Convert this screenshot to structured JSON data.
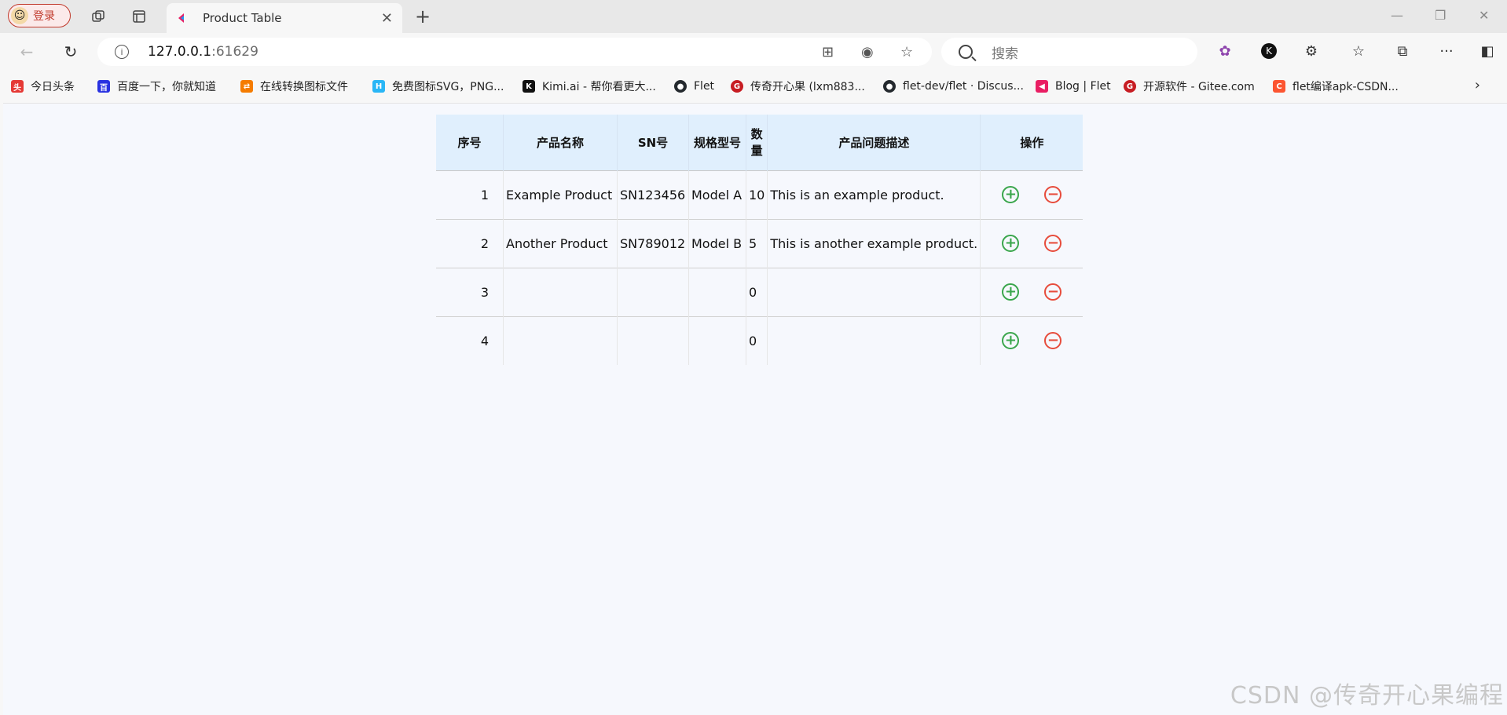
{
  "browser": {
    "profile_label": "登录",
    "tab_title": "Product Table",
    "url_host": "127.0.0.1",
    "url_port": ":61629",
    "search_placeholder": "搜索",
    "bookmarks": [
      {
        "label": "今日头条",
        "color": "#e53935"
      },
      {
        "label": "百度一下，你就知道",
        "color": "#2932e1"
      },
      {
        "label": "在线转换图标文件",
        "color": "#f57c00"
      },
      {
        "label": "免费图标SVG，PNG...",
        "color": "#29b6f6"
      },
      {
        "label": "Kimi.ai - 帮你看更大...",
        "color": "#111111"
      },
      {
        "label": "Flet",
        "color": "#24292e"
      },
      {
        "label": "传奇开心果 (lxm883...",
        "color": "#c71d23"
      },
      {
        "label": "flet-dev/flet · Discus...",
        "color": "#24292e"
      },
      {
        "label": "Blog | Flet",
        "color": "#e91e63"
      },
      {
        "label": "开源软件 - Gitee.com",
        "color": "#c71d23"
      },
      {
        "label": "flet编译apk-CSDN...",
        "color": "#fc5531"
      }
    ]
  },
  "table": {
    "headers": [
      "序号",
      "产品名称",
      "SN号",
      "规格型号",
      "数量",
      "产品问题描述",
      "操作"
    ],
    "rows": [
      {
        "idx": "1",
        "name": "Example Product",
        "sn": "SN123456",
        "model": "Model A",
        "qty": "10",
        "desc": "This is an example product."
      },
      {
        "idx": "2",
        "name": "Another Product",
        "sn": "SN789012",
        "model": "Model B",
        "qty": "5",
        "desc": "This is another example product."
      },
      {
        "idx": "3",
        "name": "",
        "sn": "",
        "model": "",
        "qty": "0",
        "desc": ""
      },
      {
        "idx": "4",
        "name": "",
        "sn": "",
        "model": "",
        "qty": "0",
        "desc": ""
      }
    ],
    "add_color": "#3aa64c",
    "delete_color": "#e74c3c"
  },
  "watermark": "CSDN @传奇开心果编程"
}
